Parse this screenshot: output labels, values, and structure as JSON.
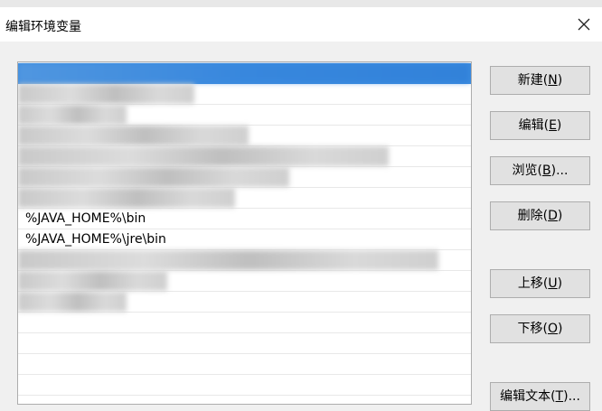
{
  "window": {
    "title": "编辑环境变量"
  },
  "list": {
    "rows": [
      {
        "text": "",
        "selected": true,
        "blur_width": 500
      },
      {
        "text": "",
        "blur_width": 195
      },
      {
        "text": "",
        "blur_width": 120
      },
      {
        "text": "",
        "blur_width": 255
      },
      {
        "text": "",
        "blur_width": 410
      },
      {
        "text": "",
        "blur_width": 300
      },
      {
        "text": "",
        "blur_width": 240
      },
      {
        "text": "%JAVA_HOME%\\bin"
      },
      {
        "text": "%JAVA_HOME%\\jre\\bin"
      },
      {
        "text": "",
        "blur_width": 465
      },
      {
        "text": "",
        "blur_width": 165
      },
      {
        "text": "",
        "blur_width": 120
      },
      {
        "text": ""
      },
      {
        "text": ""
      },
      {
        "text": ""
      },
      {
        "text": ""
      }
    ]
  },
  "buttons": [
    {
      "name": "new-button",
      "label": "新建(",
      "key": "N",
      "suffix": ")"
    },
    {
      "name": "edit-button",
      "label": "编辑(",
      "key": "E",
      "suffix": ")"
    },
    {
      "name": "browse-button",
      "label": "浏览(",
      "key": "B",
      "suffix": ")..."
    },
    {
      "name": "delete-button",
      "label": "删除(",
      "key": "D",
      "suffix": ")"
    },
    {
      "name": "move-up-button",
      "label": "上移(",
      "key": "U",
      "suffix": ")"
    },
    {
      "name": "move-down-button",
      "label": "下移(",
      "key": "O",
      "suffix": ")"
    },
    {
      "name": "edit-text-button",
      "label": "编辑文本(",
      "key": "T",
      "suffix": ")..."
    }
  ]
}
